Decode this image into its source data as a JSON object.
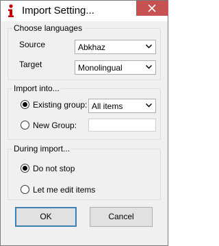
{
  "window": {
    "title": "Import Setting..."
  },
  "languages": {
    "legend": "Choose languages",
    "source_label": "Source",
    "source_value": "Abkhaz",
    "target_label": "Target",
    "target_value": "Monolingual"
  },
  "import_into": {
    "legend": "Import into...",
    "existing_label": "Existing group:",
    "existing_selected": true,
    "existing_value": "All items",
    "new_label": "New Group:",
    "new_selected": false,
    "new_value": ""
  },
  "during_import": {
    "legend": "During import...",
    "do_not_stop_label": "Do not stop",
    "do_not_stop_selected": true,
    "edit_items_label": "Let me edit items",
    "edit_items_selected": false
  },
  "buttons": {
    "ok": "OK",
    "cancel": "Cancel"
  },
  "colors": {
    "title_icon": "#c00000",
    "close_button": "#c75050",
    "group_border": "#d5dfe5",
    "dialog_background": "#f0f0f0"
  }
}
